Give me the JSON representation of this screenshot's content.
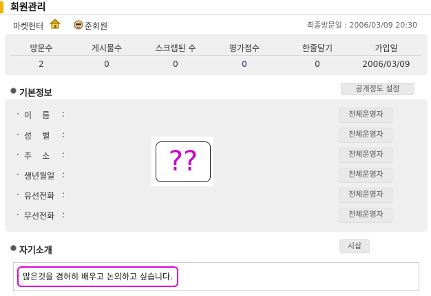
{
  "header": {
    "title": "회원관리"
  },
  "member": {
    "nickname": "마켓헌터",
    "grade": "준회원",
    "last_visit": "최종방문일 : 2006/03/09 20:30"
  },
  "stats": {
    "columns": [
      {
        "label": "방문수",
        "value": "2"
      },
      {
        "label": "게시물수",
        "value": "0"
      },
      {
        "label": "스크랩된 수",
        "value": "0"
      },
      {
        "label": "평가점수",
        "value": "0"
      },
      {
        "label": "한줄달기",
        "value": "0"
      },
      {
        "label": "가입일",
        "value": "2006/03/09"
      }
    ]
  },
  "basic_info": {
    "title": "기본정보",
    "disclosure_button": "공개정도 설정",
    "rows": [
      {
        "label": "이    름",
        "visibility": "전체운영자"
      },
      {
        "label": "성    별",
        "visibility": "전체운영자"
      },
      {
        "label": "주    소",
        "visibility": "전체운영자"
      },
      {
        "label": "생년월일",
        "visibility": "전체운영자"
      },
      {
        "label": "유선전화",
        "visibility": "전체운영자"
      },
      {
        "label": "무선전화",
        "visibility": "전체운영자"
      }
    ],
    "placeholder_mark": "??"
  },
  "intro": {
    "title": "자기소개",
    "button": "시삽",
    "text": "많은것을 겸허히 배우고 논의하고 싶습니다."
  },
  "colors": {
    "accent_bar": "#f0b400",
    "highlight": "#dd00dd",
    "stat_accent": "#1a2a8a"
  }
}
